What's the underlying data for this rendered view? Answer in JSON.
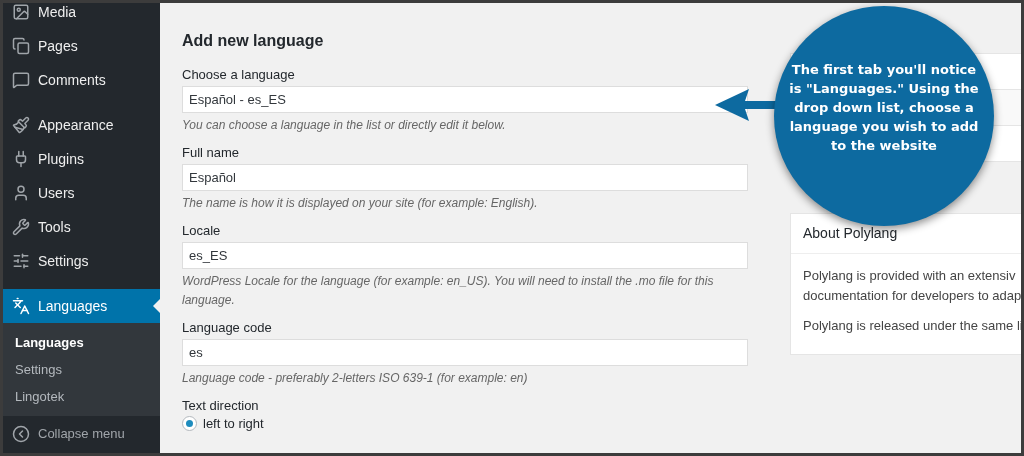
{
  "sidebar": {
    "items": [
      {
        "label": "Media",
        "selected": false
      },
      {
        "label": "Pages",
        "selected": false
      },
      {
        "label": "Comments",
        "selected": false
      },
      {
        "label": "Appearance",
        "selected": false
      },
      {
        "label": "Plugins",
        "selected": false
      },
      {
        "label": "Users",
        "selected": false
      },
      {
        "label": "Tools",
        "selected": false
      },
      {
        "label": "Settings",
        "selected": false
      },
      {
        "label": "Languages",
        "selected": true,
        "children": [
          {
            "label": "Languages",
            "selected": true
          },
          {
            "label": "Settings",
            "selected": false
          },
          {
            "label": "Lingotek",
            "selected": false
          }
        ]
      }
    ],
    "collapse": "Collapse menu"
  },
  "form": {
    "title": "Add new language",
    "fields": [
      {
        "label": "Choose a language",
        "value": "Español - es_ES",
        "hint": "You can choose a language in the list or directly edit it below."
      },
      {
        "label": "Full name",
        "value": "Español",
        "hint": "The name is how it is displayed on your site (for example: English)."
      },
      {
        "label": "Locale",
        "value": "es_ES",
        "hint": "WordPress Locale for the language (for example: en_US). You will need to install the .mo file for this language."
      },
      {
        "label": "Language code",
        "value": "es",
        "hint": "Language code - preferably 2-letters ISO 639-1 (for example: en)"
      }
    ],
    "text_direction": {
      "label": "Text direction",
      "options": [
        {
          "label": "left to right",
          "selected": true
        }
      ]
    }
  },
  "about": {
    "title": "About Polylang",
    "paragraphs": [
      "Polylang is provided with an extensiv",
      "documentation for developers to adap",
      "Polylang is released under the same li"
    ]
  },
  "callout": {
    "text": "The first tab you'll notice is \"Languages.\" Using the drop down list, choose a language you wish to add to the website"
  }
}
